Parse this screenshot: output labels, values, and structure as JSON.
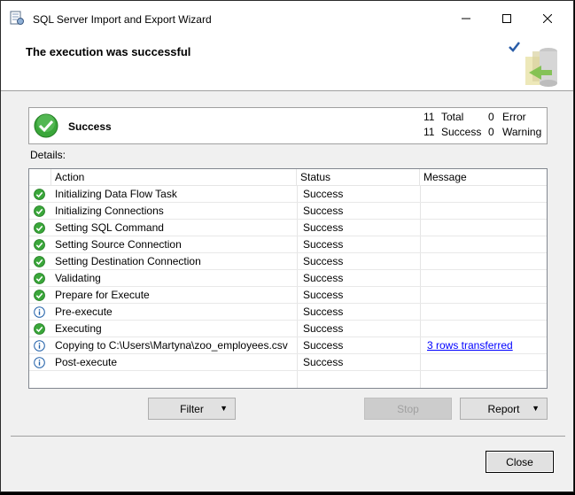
{
  "window": {
    "title": "SQL Server Import and Export Wizard"
  },
  "header": {
    "title": "The execution was successful"
  },
  "summary": {
    "status": "Success",
    "total_count": "11",
    "total_label": "Total",
    "error_count": "0",
    "error_label": "Error",
    "success_count": "11",
    "success_label": "Success",
    "warning_count": "0",
    "warning_label": "Warning"
  },
  "details": {
    "label": "Details:",
    "columns": [
      "Action",
      "Status",
      "Message"
    ],
    "rows": [
      {
        "icon": "success-icon",
        "action": "Initializing Data Flow Task",
        "status": "Success",
        "message": ""
      },
      {
        "icon": "success-icon",
        "action": "Initializing Connections",
        "status": "Success",
        "message": ""
      },
      {
        "icon": "success-icon",
        "action": "Setting SQL Command",
        "status": "Success",
        "message": ""
      },
      {
        "icon": "success-icon",
        "action": "Setting Source Connection",
        "status": "Success",
        "message": ""
      },
      {
        "icon": "success-icon",
        "action": "Setting Destination Connection",
        "status": "Success",
        "message": ""
      },
      {
        "icon": "success-icon",
        "action": "Validating",
        "status": "Success",
        "message": ""
      },
      {
        "icon": "success-icon",
        "action": "Prepare for Execute",
        "status": "Success",
        "message": ""
      },
      {
        "icon": "info-icon",
        "action": "Pre-execute",
        "status": "Success",
        "message": ""
      },
      {
        "icon": "success-icon",
        "action": "Executing",
        "status": "Success",
        "message": ""
      },
      {
        "icon": "info-icon",
        "action": "Copying to C:\\Users\\Martyna\\zoo_employees.csv",
        "status": "Success",
        "message": "3 rows transferred"
      },
      {
        "icon": "info-icon",
        "action": "Post-execute",
        "status": "Success",
        "message": ""
      }
    ]
  },
  "buttons": {
    "filter": "Filter",
    "stop": "Stop",
    "report": "Report",
    "close": "Close"
  },
  "colors": {
    "success_green": "#3aa63a",
    "info_blue": "#1f5fa8",
    "link": "#0000ff",
    "accent": "#0078d7"
  }
}
